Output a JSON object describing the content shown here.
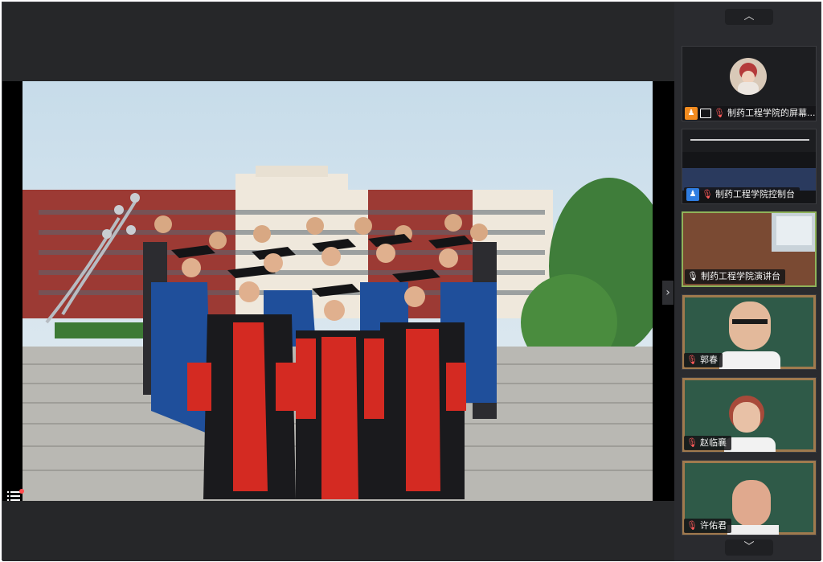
{
  "participants": [
    {
      "name": "制药工程学院的屏幕...",
      "mic": "mic-muted",
      "icons": [
        "host-badge",
        "screen-share"
      ],
      "avatar": "baby-photo"
    },
    {
      "name": "制药工程学院控制台",
      "mic": "mic-muted",
      "icons": [
        "user-badge"
      ],
      "avatar": "auditorium-video"
    },
    {
      "name": "制药工程学院演讲台",
      "mic": "mic-on",
      "icons": [],
      "avatar": "room-video"
    },
    {
      "name": "郭春",
      "mic": "mic-muted",
      "icons": [],
      "avatar": "man-glasses-video"
    },
    {
      "name": "赵临襄",
      "mic": "mic-muted",
      "icons": [],
      "avatar": "woman-glasses-video"
    },
    {
      "name": "许佑君",
      "mic": "mic-muted",
      "icons": [],
      "avatar": "man-video"
    }
  ],
  "colors": {
    "window_bg": "#242529",
    "sidebar_bg": "#2a2b2f",
    "active_speaker_border": "#8fb35a",
    "chalkboard": "#2f5a48"
  }
}
